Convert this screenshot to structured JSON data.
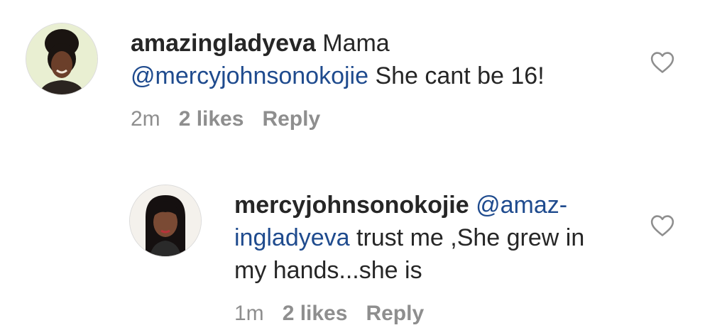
{
  "comments": [
    {
      "username": "amazingladyeva",
      "text_before": " Mama",
      "mention": "@mercyjohnsonokojie",
      "text_after": " She cant be 16!",
      "time": "2m",
      "likes": "2 likes",
      "reply": "Reply",
      "avatar": "avatar-icon",
      "like_icon": "heart-outline-icon"
    },
    {
      "username": "mercyjohnsonokojie",
      "mention_part1": " @amaz-",
      "mention_part2": "ingladyeva",
      "text_after": " trust me ,She grew in my hands...she is",
      "time": "1m",
      "likes": "2 likes",
      "reply": "Reply",
      "avatar": "avatar-icon",
      "like_icon": "heart-outline-icon"
    }
  ]
}
